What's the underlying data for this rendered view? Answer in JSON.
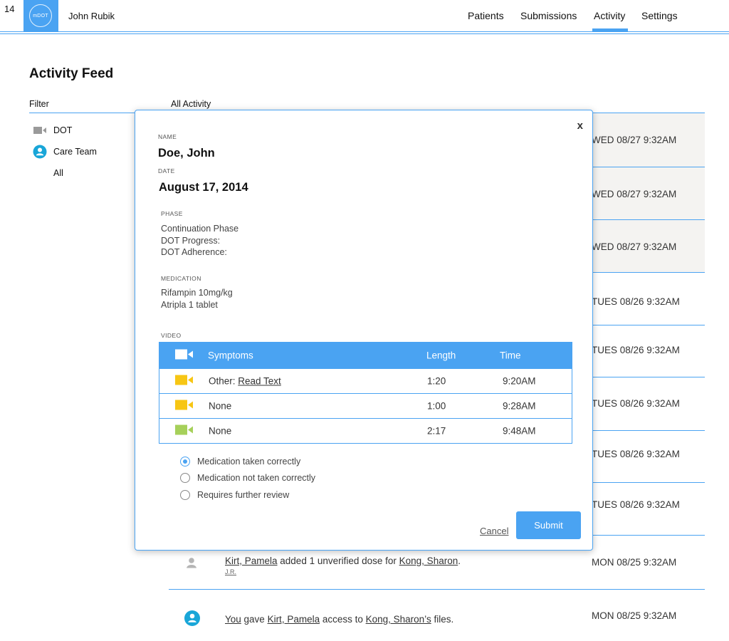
{
  "page_number": "14",
  "header": {
    "logo_text": "mDOT",
    "user_name": "John Rubik",
    "nav": [
      "Patients",
      "Submissions",
      "Activity",
      "Settings"
    ],
    "active_nav": "Activity",
    "accent_color": "#4aa3f2"
  },
  "main": {
    "title": "Activity Feed",
    "filter_label": "Filter",
    "filters": [
      {
        "label": "DOT",
        "icon": "video-camera-icon"
      },
      {
        "label": "Care Team",
        "icon": "person-circle-icon"
      },
      {
        "label": "All",
        "icon": ""
      }
    ],
    "feed_label": "All Activity",
    "feed": [
      {
        "time": "WED 08/27 9:32AM",
        "highlighted": true
      },
      {
        "time": "WED 08/27 9:32AM",
        "highlighted": true
      },
      {
        "time": "WED 08/27 9:32AM",
        "highlighted": true
      },
      {
        "time": "TUES 08/26 9:32AM",
        "highlighted": false
      },
      {
        "time": "TUES 08/26 9:32AM",
        "highlighted": false
      },
      {
        "time": "TUES 08/26 9:32AM",
        "highlighted": false
      },
      {
        "time": "TUES 08/26 9:32AM",
        "highlighted": false
      },
      {
        "time": "TUES 08/26 9:32AM",
        "highlighted": false
      },
      {
        "time": "MON 08/25 9:32AM",
        "link1": "Kirt, Pamela",
        "middle": " added 1 unverified dose for ",
        "link2": "Kong, Sharon",
        "end": ".",
        "initials": "J.R."
      },
      {
        "time": "MON 08/25 9:32AM",
        "link1": "You",
        "middle": " gave ",
        "link2": "Kirt, Pamela",
        "middle2": " access to ",
        "link3": "Kong, Sharon’s",
        "end": " files."
      }
    ]
  },
  "modal": {
    "close_label": "x",
    "name_label": "NAME",
    "name_value": "Doe, John",
    "date_label": "DATE",
    "date_value": "August 17, 2014",
    "phase_label": "PHASE",
    "phase_lines": [
      "Continuation Phase",
      "DOT Progress:",
      "DOT Adherence:"
    ],
    "medication_label": "MEDICATION",
    "medication_lines": [
      "Rifampin 10mg/kg",
      "Atripla 1 tablet"
    ],
    "video_label": "VIDEO",
    "video_table": {
      "headers": [
        "Symptoms",
        "Length",
        "Time"
      ],
      "rows": [
        {
          "prefix": "Other: ",
          "link": "Read Text",
          "length": "1:20",
          "time": "9:20AM",
          "icon_color": "#f7c614"
        },
        {
          "prefix": "None",
          "link": "",
          "length": "1:00",
          "time": "9:28AM",
          "icon_color": "#f7c614"
        },
        {
          "prefix": "None",
          "link": "",
          "length": "2:17",
          "time": "9:48AM",
          "icon_color": "#a6d05a"
        }
      ]
    },
    "options": [
      {
        "label": "Medication taken correctly",
        "selected": true
      },
      {
        "label": "Medication not taken correctly",
        "selected": false
      },
      {
        "label": "Requires further review",
        "selected": false
      }
    ],
    "cancel_label": "Cancel",
    "submit_label": "Submit"
  }
}
